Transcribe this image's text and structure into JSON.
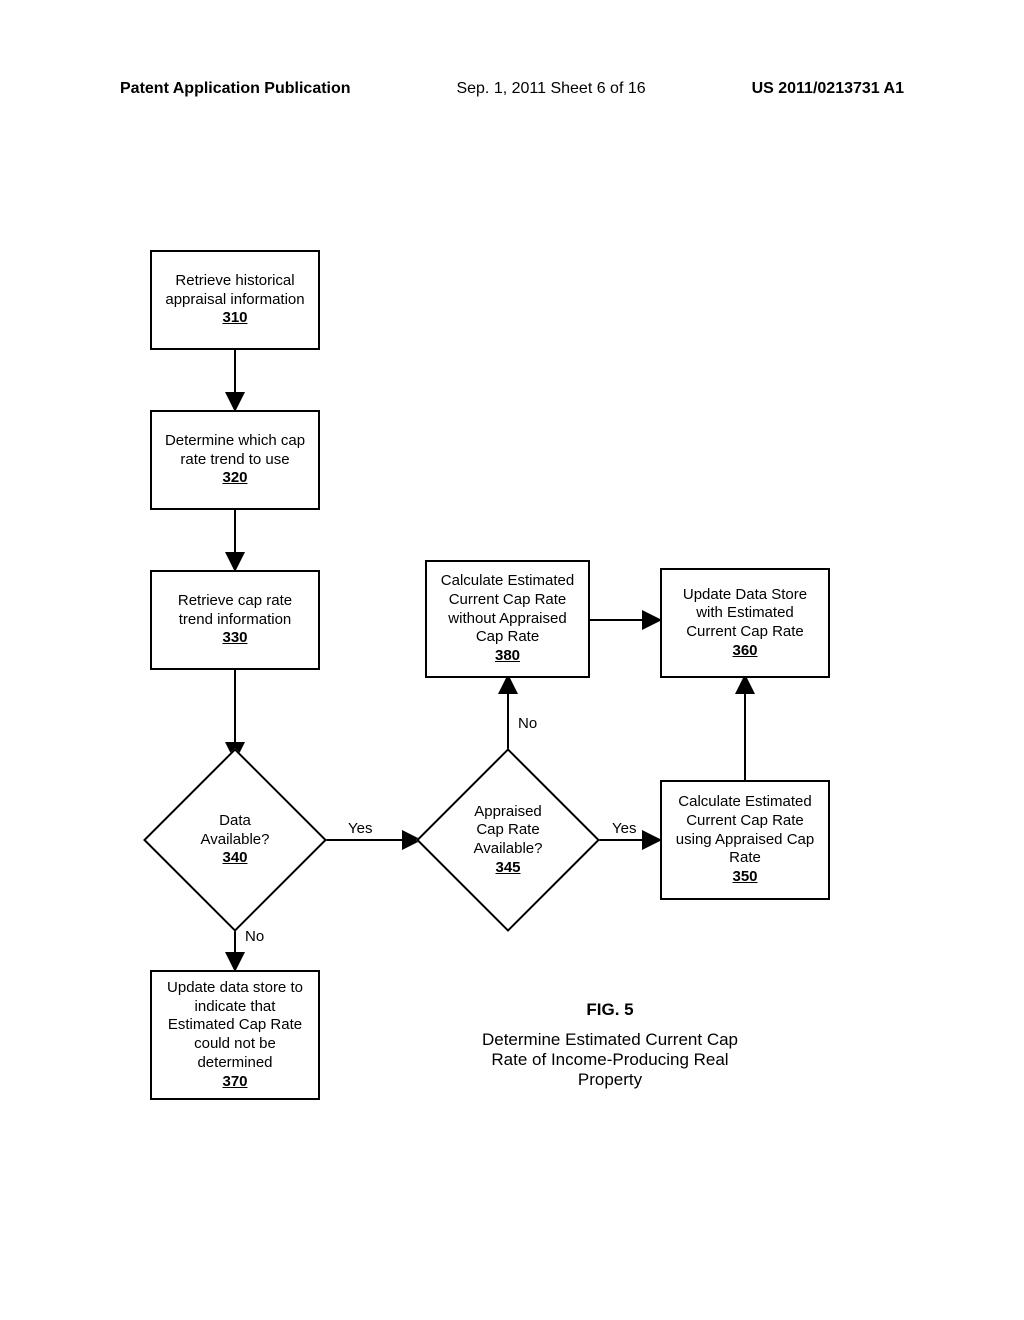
{
  "header": {
    "left": "Patent Application Publication",
    "center": "Sep. 1, 2011   Sheet 6 of 16",
    "right": "US 2011/0213731 A1"
  },
  "nodes": {
    "n310": {
      "line1": "Retrieve historical",
      "line2": "appraisal information",
      "ref": "310"
    },
    "n320": {
      "line1": "Determine which cap",
      "line2": "rate trend to use",
      "ref": "320"
    },
    "n330": {
      "line1": "Retrieve cap rate",
      "line2": "trend information",
      "ref": "330"
    },
    "n340": {
      "line1": "Data",
      "line2": "Available?",
      "ref": "340"
    },
    "n345": {
      "line1": "Appraised",
      "line2": "Cap Rate",
      "line3": "Available?",
      "ref": "345"
    },
    "n350": {
      "line1": "Calculate Estimated",
      "line2": "Current Cap Rate",
      "line3": "using Appraised Cap",
      "line4": "Rate",
      "ref": "350"
    },
    "n360": {
      "line1": "Update Data Store",
      "line2": "with Estimated",
      "line3": "Current Cap Rate",
      "ref": "360"
    },
    "n370": {
      "line1": "Update data store to",
      "line2": "indicate that",
      "line3": "Estimated Cap Rate",
      "line4": "could not be",
      "line5": "determined",
      "ref": "370"
    },
    "n380": {
      "line1": "Calculate Estimated",
      "line2": "Current Cap Rate",
      "line3": "without Appraised",
      "line4": "Cap Rate",
      "ref": "380"
    }
  },
  "edgeLabels": {
    "yes1": "Yes",
    "no1": "No",
    "yes2": "Yes",
    "no2": "No"
  },
  "figure": {
    "num": "FIG. 5",
    "caption_l1": "Determine Estimated Current Cap",
    "caption_l2": "Rate of Income-Producing Real",
    "caption_l3": "Property"
  }
}
